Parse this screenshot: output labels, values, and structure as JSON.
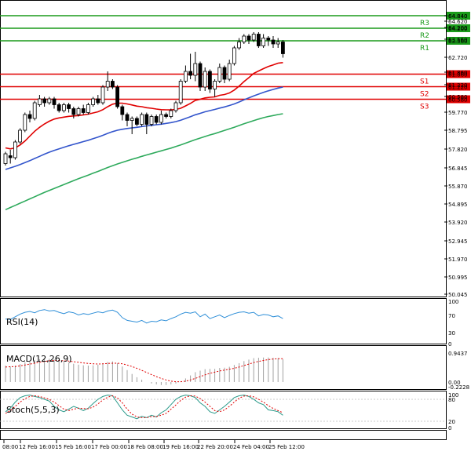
{
  "chart_data": {
    "type": "candlestick",
    "price_axis_ticks": [
      "64.840",
      "64.620",
      "64.200",
      "63.560",
      "62.720",
      "61.860",
      "61.220",
      "60.580",
      "59.770",
      "58.795",
      "57.820",
      "56.845",
      "55.870",
      "54.895",
      "53.920",
      "52.945",
      "51.970",
      "50.995",
      "50.045"
    ],
    "current_price": "62.720",
    "levels": [
      {
        "name": "R3",
        "price": 64.84,
        "value": "64.840",
        "color": "#1a9a1a"
      },
      {
        "name": "R2",
        "price": 64.2,
        "value": "64.200",
        "color": "#1a9a1a"
      },
      {
        "name": "R1",
        "price": 63.56,
        "value": "63.560",
        "color": "#1a9a1a"
      },
      {
        "name": "S1",
        "price": 61.86,
        "value": "61.860",
        "color": "#e00000"
      },
      {
        "name": "S2",
        "price": 61.22,
        "value": "61.220",
        "color": "#e00000"
      },
      {
        "name": "S3",
        "price": 60.58,
        "value": "60.580",
        "color": "#e00000"
      }
    ],
    "time_labels": [
      "08:00",
      "12 Feb 16:00",
      "15 Feb 16:00",
      "17 Feb 00:00",
      "18 Feb 08:00",
      "19 Feb 16:00",
      "22 Feb 20:00",
      "24 Feb 04:00",
      "25 Feb 12:00"
    ],
    "candles": [
      [
        57.3,
        57.8,
        57.2,
        57.9
      ],
      [
        57.7,
        57.6,
        57.3,
        58.0
      ],
      [
        57.6,
        58.4,
        57.5,
        58.5
      ],
      [
        58.4,
        59.0,
        58.3,
        59.1
      ],
      [
        59.0,
        59.8,
        58.9,
        59.9
      ],
      [
        59.8,
        59.6,
        59.4,
        60.0
      ],
      [
        59.6,
        60.4,
        59.5,
        60.5
      ],
      [
        60.3,
        60.6,
        60.2,
        60.8
      ],
      [
        60.6,
        60.4,
        60.2,
        60.7
      ],
      [
        60.4,
        60.6,
        60.3,
        60.7
      ],
      [
        60.6,
        60.3,
        60.1,
        60.7
      ],
      [
        60.3,
        60.0,
        59.9,
        60.4
      ],
      [
        60.0,
        60.3,
        59.9,
        60.4
      ],
      [
        60.3,
        60.1,
        59.9,
        60.4
      ],
      [
        60.1,
        59.8,
        59.6,
        60.2
      ],
      [
        59.8,
        60.1,
        59.7,
        60.2
      ],
      [
        60.1,
        59.9,
        59.8,
        60.3
      ],
      [
        59.9,
        60.3,
        59.8,
        60.4
      ],
      [
        60.3,
        60.6,
        60.2,
        60.7
      ],
      [
        60.6,
        60.4,
        60.3,
        60.8
      ],
      [
        60.4,
        61.2,
        60.3,
        61.3
      ],
      [
        61.2,
        61.5,
        61.0,
        62.0
      ],
      [
        61.5,
        61.2,
        61.1,
        61.6
      ],
      [
        61.2,
        60.2,
        60.1,
        61.3
      ],
      [
        60.2,
        59.8,
        59.5,
        60.3
      ],
      [
        59.8,
        59.5,
        59.2,
        59.9
      ],
      [
        59.5,
        59.6,
        58.8,
        59.7
      ],
      [
        59.6,
        59.3,
        59.2,
        59.7
      ],
      [
        59.3,
        59.8,
        59.2,
        59.9
      ],
      [
        59.8,
        59.3,
        58.8,
        59.9
      ],
      [
        59.3,
        59.7,
        59.2,
        59.8
      ],
      [
        59.7,
        59.4,
        59.3,
        59.8
      ],
      [
        59.4,
        59.8,
        59.3,
        60.0
      ],
      [
        59.8,
        59.7,
        59.6,
        59.9
      ],
      [
        59.7,
        60.0,
        59.6,
        60.1
      ],
      [
        60.0,
        60.4,
        59.9,
        60.5
      ],
      [
        60.4,
        61.5,
        60.3,
        61.6
      ],
      [
        61.5,
        62.0,
        61.4,
        62.3
      ],
      [
        62.0,
        61.8,
        61.6,
        62.9
      ],
      [
        61.8,
        62.4,
        61.5,
        63.0
      ],
      [
        62.4,
        61.2,
        61.0,
        62.5
      ],
      [
        61.2,
        62.0,
        61.0,
        62.2
      ],
      [
        62.0,
        61.1,
        60.9,
        62.1
      ],
      [
        61.1,
        61.5,
        60.7,
        61.6
      ],
      [
        61.5,
        62.2,
        61.4,
        62.4
      ],
      [
        62.2,
        61.6,
        61.4,
        62.3
      ],
      [
        61.6,
        62.4,
        61.5,
        62.6
      ],
      [
        62.4,
        63.2,
        62.3,
        63.3
      ],
      [
        63.2,
        63.5,
        63.1,
        63.7
      ],
      [
        63.5,
        63.8,
        63.4,
        63.9
      ],
      [
        63.8,
        63.6,
        63.4,
        63.9
      ],
      [
        63.6,
        63.9,
        63.5,
        64.0
      ],
      [
        63.9,
        63.3,
        63.2,
        64.0
      ],
      [
        63.3,
        63.7,
        63.2,
        63.9
      ],
      [
        63.7,
        63.6,
        63.3,
        63.8
      ],
      [
        63.6,
        63.4,
        63.2,
        63.8
      ],
      [
        63.4,
        63.5,
        63.2,
        63.7
      ],
      [
        63.5,
        62.9,
        62.7,
        63.6
      ]
    ],
    "ma_series": [
      {
        "color": "#e00000",
        "values": [
          58.1,
          58.05,
          58.1,
          58.25,
          58.45,
          58.7,
          58.95,
          59.15,
          59.32,
          59.46,
          59.57,
          59.63,
          59.67,
          59.71,
          59.73,
          59.75,
          59.78,
          59.82,
          59.88,
          59.94,
          60.05,
          60.2,
          60.33,
          60.38,
          60.38,
          60.34,
          60.29,
          60.23,
          60.2,
          60.15,
          60.12,
          60.08,
          60.05,
          60.04,
          60.04,
          60.06,
          60.12,
          60.24,
          60.37,
          60.52,
          60.58,
          60.65,
          60.68,
          60.7,
          60.78,
          60.82,
          60.9,
          61.05,
          61.25,
          61.48,
          61.68,
          61.9,
          62.02,
          62.14,
          62.25,
          62.33,
          62.42,
          62.45
        ]
      },
      {
        "color": "#3355cc",
        "values": [
          57.0,
          57.08,
          57.16,
          57.25,
          57.35,
          57.45,
          57.56,
          57.67,
          57.78,
          57.88,
          57.97,
          58.05,
          58.13,
          58.21,
          58.28,
          58.35,
          58.42,
          58.49,
          58.57,
          58.65,
          58.74,
          58.84,
          58.93,
          59.0,
          59.05,
          59.09,
          59.12,
          59.15,
          59.19,
          59.22,
          59.25,
          59.28,
          59.31,
          59.35,
          59.39,
          59.44,
          59.51,
          59.6,
          59.69,
          59.79,
          59.86,
          59.94,
          60.0,
          60.06,
          60.13,
          60.19,
          60.26,
          60.34,
          60.44,
          60.55,
          60.65,
          60.75,
          60.84,
          60.93,
          61.01,
          61.08,
          61.15,
          61.2
        ]
      },
      {
        "color": "#2eaa5c",
        "values": [
          54.95,
          55.06,
          55.17,
          55.28,
          55.39,
          55.5,
          55.61,
          55.72,
          55.83,
          55.93,
          56.03,
          56.13,
          56.23,
          56.33,
          56.43,
          56.53,
          56.62,
          56.71,
          56.81,
          56.9,
          57.0,
          57.1,
          57.19,
          57.28,
          57.36,
          57.44,
          57.52,
          57.59,
          57.67,
          57.74,
          57.81,
          57.88,
          57.95,
          58.02,
          58.09,
          58.17,
          58.25,
          58.34,
          58.43,
          58.52,
          58.6,
          58.68,
          58.76,
          58.83,
          58.91,
          58.99,
          59.07,
          59.15,
          59.24,
          59.33,
          59.41,
          59.49,
          59.57,
          59.64,
          59.7,
          59.75,
          59.8,
          59.84
        ]
      }
    ],
    "rsi": {
      "label": "RSI(14)",
      "ticks": [
        "100",
        "70",
        "30",
        "0"
      ],
      "values": [
        55,
        54,
        60,
        66,
        70,
        72,
        69,
        74,
        76,
        73,
        74,
        70,
        67,
        71,
        69,
        64,
        67,
        65,
        68,
        71,
        69,
        73,
        75,
        70,
        58,
        52,
        50,
        48,
        52,
        46,
        50,
        49,
        53,
        51,
        56,
        60,
        66,
        70,
        68,
        71,
        60,
        66,
        56,
        60,
        64,
        58,
        63,
        67,
        70,
        71,
        68,
        70,
        62,
        65,
        64,
        60,
        62,
        56
      ]
    },
    "macd": {
      "label": "MACD(12,26,9)",
      "ticks": [
        "0.9437",
        "0.00",
        "-0.2228"
      ],
      "histogram": [
        0.55,
        0.52,
        0.55,
        0.6,
        0.66,
        0.7,
        0.73,
        0.76,
        0.78,
        0.78,
        0.76,
        0.72,
        0.68,
        0.65,
        0.61,
        0.58,
        0.56,
        0.55,
        0.56,
        0.58,
        0.62,
        0.67,
        0.69,
        0.63,
        0.52,
        0.4,
        0.27,
        0.16,
        0.08,
        0.0,
        -0.05,
        -0.08,
        -0.1,
        -0.1,
        -0.08,
        -0.05,
        0.02,
        0.12,
        0.22,
        0.33,
        0.38,
        0.43,
        0.44,
        0.44,
        0.47,
        0.48,
        0.51,
        0.57,
        0.63,
        0.7,
        0.75,
        0.8,
        0.81,
        0.82,
        0.82,
        0.81,
        0.8,
        0.76
      ],
      "signal": [
        0.5,
        0.51,
        0.52,
        0.54,
        0.57,
        0.6,
        0.63,
        0.66,
        0.69,
        0.71,
        0.72,
        0.72,
        0.71,
        0.7,
        0.68,
        0.66,
        0.64,
        0.62,
        0.61,
        0.6,
        0.61,
        0.62,
        0.63,
        0.63,
        0.61,
        0.57,
        0.52,
        0.46,
        0.39,
        0.32,
        0.25,
        0.18,
        0.12,
        0.07,
        0.03,
        0.01,
        0.01,
        0.03,
        0.07,
        0.12,
        0.18,
        0.24,
        0.29,
        0.33,
        0.37,
        0.4,
        0.43,
        0.46,
        0.5,
        0.55,
        0.6,
        0.65,
        0.69,
        0.72,
        0.75,
        0.77,
        0.78,
        0.78
      ]
    },
    "stoch": {
      "label": "Stoch(5,5,3)",
      "ticks": [
        "100",
        "80",
        "20",
        "0"
      ],
      "k": [
        45,
        55,
        72,
        85,
        90,
        92,
        88,
        85,
        80,
        75,
        60,
        50,
        45,
        52,
        60,
        55,
        48,
        55,
        68,
        80,
        88,
        92,
        90,
        70,
        50,
        35,
        30,
        25,
        32,
        28,
        35,
        30,
        42,
        50,
        65,
        80,
        88,
        92,
        90,
        85,
        70,
        60,
        45,
        40,
        50,
        60,
        72,
        85,
        90,
        92,
        88,
        80,
        70,
        65,
        50,
        48,
        45,
        35
      ],
      "d": [
        40,
        48,
        60,
        72,
        82,
        88,
        90,
        88,
        84,
        80,
        72,
        62,
        52,
        48,
        52,
        55,
        54,
        53,
        58,
        67,
        78,
        86,
        90,
        84,
        70,
        52,
        38,
        30,
        28,
        28,
        31,
        31,
        35,
        40,
        52,
        64,
        77,
        86,
        90,
        89,
        82,
        72,
        60,
        48,
        45,
        50,
        60,
        72,
        83,
        89,
        90,
        87,
        80,
        72,
        62,
        54,
        48,
        42
      ]
    }
  }
}
